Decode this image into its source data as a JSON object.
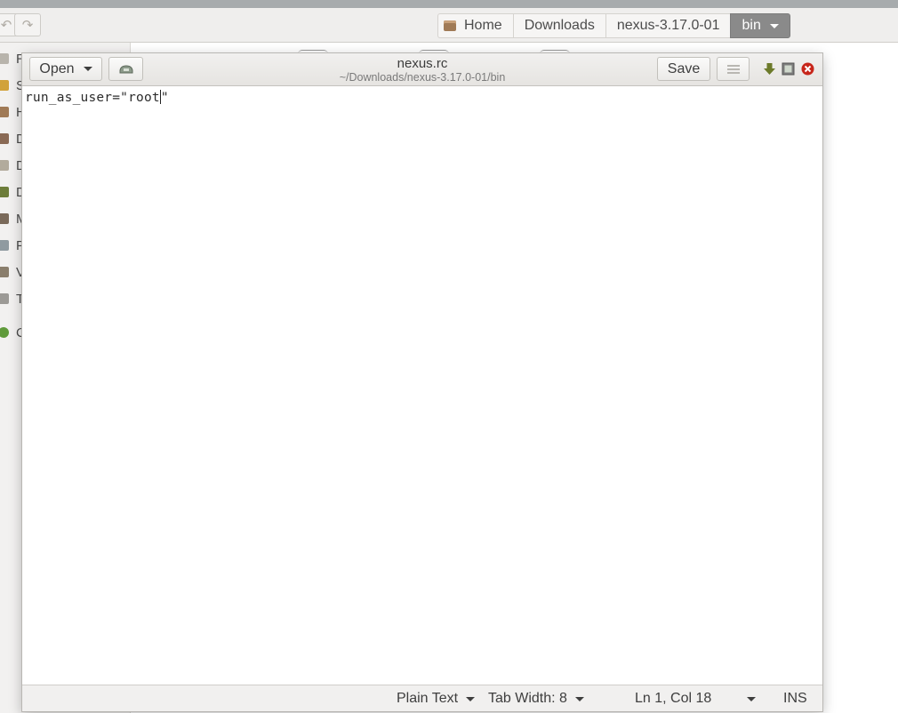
{
  "file_manager": {
    "breadcrumb": [
      "Home",
      "Downloads",
      "nexus-3.17.0-01",
      "bin"
    ],
    "sidebar_visible_initials": [
      "R",
      "S",
      "H",
      "D",
      "D",
      "D",
      "M",
      "P",
      "V",
      "T",
      "C"
    ]
  },
  "editor": {
    "open_label": "Open",
    "save_label": "Save",
    "title": "nexus.rc",
    "subtitle": "~/Downloads/nexus-3.17.0-01/bin",
    "content_before_cursor": "run_as_user=\"root",
    "content_after_cursor": "\"",
    "status": {
      "language": "Plain Text",
      "tab_width": "Tab Width: 8",
      "position": "Ln 1, Col 18",
      "mode": "INS"
    }
  },
  "colors": {
    "breadcrumb_active_bg": "#8a8a8a",
    "close_button": "#c7261b",
    "download_icon": "#6c7a2a"
  }
}
